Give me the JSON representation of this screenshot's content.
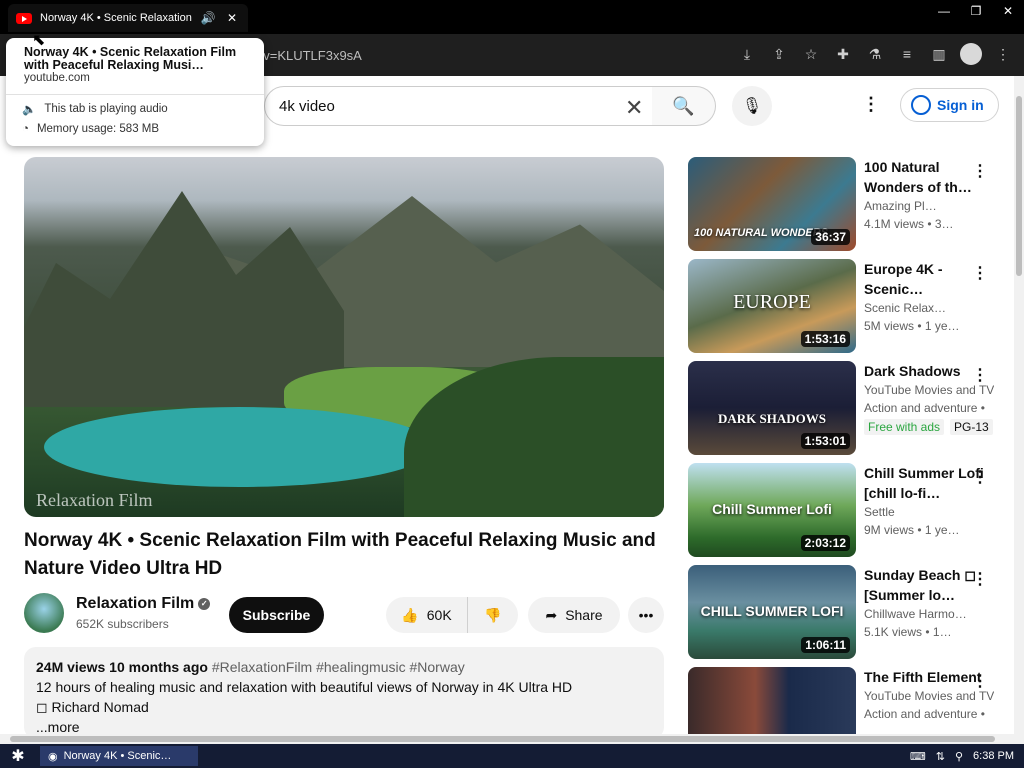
{
  "browser": {
    "tab_title": "Norway 4K • Scenic Relaxation",
    "address": "?v=KLUTLF3x9sA",
    "tooltip": {
      "title": "Norway 4K • Scenic Relaxation Film with Peaceful Relaxing Musi…",
      "domain": "youtube.com",
      "audio": "This tab is playing audio",
      "memory": "Memory usage: 583 MB"
    }
  },
  "header": {
    "search_value": "4k video",
    "signin_label": "Sign in"
  },
  "video": {
    "watermark": "Relaxation Film",
    "title": "Norway 4K • Scenic Relaxation Film with Peaceful Relaxing Music and Nature Video Ultra HD",
    "channel": "Relaxation Film",
    "subscribers": "652K subscribers",
    "subscribe_label": "Subscribe",
    "likes": "60K",
    "share_label": "Share",
    "views": "24M views",
    "age": "10 months ago",
    "hashtags": "#RelaxationFilm #healingmusic #Norway",
    "desc_line1": "12 hours of healing music and relaxation with beautiful views of Norway in 4K Ultra HD",
    "desc_line2": "Richard Nomad",
    "more_label": "...more"
  },
  "sidebar": {
    "items": [
      {
        "title": "100 Natural Wonders of th…",
        "channel": "Amazing Pl…",
        "meta": "4.1M views  • 3…",
        "duration": "36:37",
        "thumb_text": "100 NATURAL WONDERS"
      },
      {
        "title": "Europe 4K - Scenic…",
        "channel": "Scenic Relax…",
        "meta": "5M views  • 1 ye…",
        "duration": "1:53:16",
        "thumb_text": "EUROPE"
      },
      {
        "title": "Dark Shadows",
        "channel": "YouTube Movies and TV",
        "meta": "Action and adventure •",
        "duration": "1:53:01",
        "thumb_text": "DARK SHADOWS",
        "badge1": "Free with ads",
        "badge2": "PG-13"
      },
      {
        "title": "Chill Summer Lofi [chill lo-fi…",
        "channel": "Settle",
        "meta": "9M views  • 1 ye…",
        "duration": "2:03:12",
        "thumb_text": "Chill Summer Lofi"
      },
      {
        "title": "Sunday Beach ◻ [Summer lo…",
        "channel": "Chillwave Harmo…",
        "meta": "5.1K views  • 1…",
        "duration": "1:06:11",
        "thumb_text": "CHILL SUMMER LOFI"
      },
      {
        "title": "The Fifth Element",
        "channel": "YouTube Movies and TV",
        "meta": "Action and adventure •",
        "duration": "",
        "thumb_text": ""
      }
    ]
  },
  "taskbar": {
    "task_label": "Norway 4K • Scenic…",
    "time": "6:38 PM"
  }
}
